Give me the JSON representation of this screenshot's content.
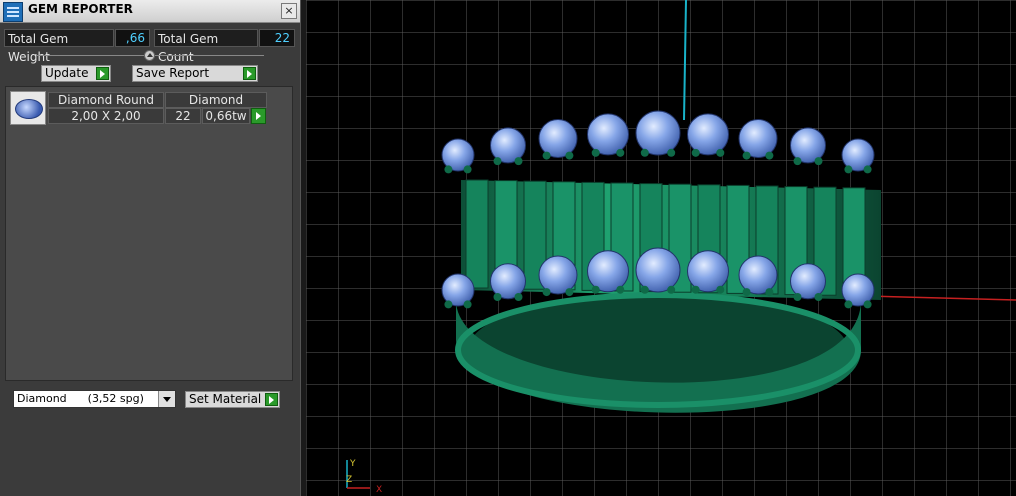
{
  "window": {
    "title": "GEM REPORTER",
    "close_label": "×"
  },
  "summary": {
    "total_weight_label": "Total Gem Weight",
    "total_weight_value": ",66",
    "total_count_label": "Total Gem Count",
    "total_count_value": "22"
  },
  "buttons": {
    "update_label": "Update",
    "save_report_label": "Save Report",
    "set_material_label": "Set Material"
  },
  "gem_table": {
    "row": {
      "shape": "Diamond Round",
      "material": "Diamond",
      "size": "2,00 X 2,00",
      "count": "22",
      "weight": "0,66tw"
    }
  },
  "material_select": {
    "selected": "Diamond      (3,52 spg)"
  },
  "viewport": {
    "axis_labels": {
      "x": "X",
      "y": "Y",
      "z": "Z"
    },
    "colors": {
      "metal": "#17805a",
      "gem": "#7f9fe0",
      "grid": "#5a5a5a",
      "x_axis": "#c62020",
      "z_axis": "#19b3c9"
    }
  }
}
